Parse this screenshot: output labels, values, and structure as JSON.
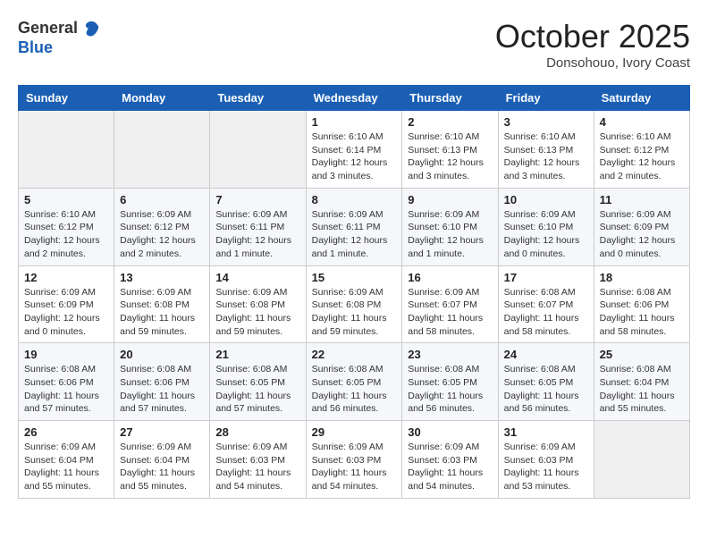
{
  "logo": {
    "general": "General",
    "blue": "Blue"
  },
  "title": "October 2025",
  "location": "Donsohouo, Ivory Coast",
  "weekdays": [
    "Sunday",
    "Monday",
    "Tuesday",
    "Wednesday",
    "Thursday",
    "Friday",
    "Saturday"
  ],
  "weeks": [
    [
      {
        "day": "",
        "info": ""
      },
      {
        "day": "",
        "info": ""
      },
      {
        "day": "",
        "info": ""
      },
      {
        "day": "1",
        "info": "Sunrise: 6:10 AM\nSunset: 6:14 PM\nDaylight: 12 hours and 3 minutes."
      },
      {
        "day": "2",
        "info": "Sunrise: 6:10 AM\nSunset: 6:13 PM\nDaylight: 12 hours and 3 minutes."
      },
      {
        "day": "3",
        "info": "Sunrise: 6:10 AM\nSunset: 6:13 PM\nDaylight: 12 hours and 3 minutes."
      },
      {
        "day": "4",
        "info": "Sunrise: 6:10 AM\nSunset: 6:12 PM\nDaylight: 12 hours and 2 minutes."
      }
    ],
    [
      {
        "day": "5",
        "info": "Sunrise: 6:10 AM\nSunset: 6:12 PM\nDaylight: 12 hours and 2 minutes."
      },
      {
        "day": "6",
        "info": "Sunrise: 6:09 AM\nSunset: 6:12 PM\nDaylight: 12 hours and 2 minutes."
      },
      {
        "day": "7",
        "info": "Sunrise: 6:09 AM\nSunset: 6:11 PM\nDaylight: 12 hours and 1 minute."
      },
      {
        "day": "8",
        "info": "Sunrise: 6:09 AM\nSunset: 6:11 PM\nDaylight: 12 hours and 1 minute."
      },
      {
        "day": "9",
        "info": "Sunrise: 6:09 AM\nSunset: 6:10 PM\nDaylight: 12 hours and 1 minute."
      },
      {
        "day": "10",
        "info": "Sunrise: 6:09 AM\nSunset: 6:10 PM\nDaylight: 12 hours and 0 minutes."
      },
      {
        "day": "11",
        "info": "Sunrise: 6:09 AM\nSunset: 6:09 PM\nDaylight: 12 hours and 0 minutes."
      }
    ],
    [
      {
        "day": "12",
        "info": "Sunrise: 6:09 AM\nSunset: 6:09 PM\nDaylight: 12 hours and 0 minutes."
      },
      {
        "day": "13",
        "info": "Sunrise: 6:09 AM\nSunset: 6:08 PM\nDaylight: 11 hours and 59 minutes."
      },
      {
        "day": "14",
        "info": "Sunrise: 6:09 AM\nSunset: 6:08 PM\nDaylight: 11 hours and 59 minutes."
      },
      {
        "day": "15",
        "info": "Sunrise: 6:09 AM\nSunset: 6:08 PM\nDaylight: 11 hours and 59 minutes."
      },
      {
        "day": "16",
        "info": "Sunrise: 6:09 AM\nSunset: 6:07 PM\nDaylight: 11 hours and 58 minutes."
      },
      {
        "day": "17",
        "info": "Sunrise: 6:08 AM\nSunset: 6:07 PM\nDaylight: 11 hours and 58 minutes."
      },
      {
        "day": "18",
        "info": "Sunrise: 6:08 AM\nSunset: 6:06 PM\nDaylight: 11 hours and 58 minutes."
      }
    ],
    [
      {
        "day": "19",
        "info": "Sunrise: 6:08 AM\nSunset: 6:06 PM\nDaylight: 11 hours and 57 minutes."
      },
      {
        "day": "20",
        "info": "Sunrise: 6:08 AM\nSunset: 6:06 PM\nDaylight: 11 hours and 57 minutes."
      },
      {
        "day": "21",
        "info": "Sunrise: 6:08 AM\nSunset: 6:05 PM\nDaylight: 11 hours and 57 minutes."
      },
      {
        "day": "22",
        "info": "Sunrise: 6:08 AM\nSunset: 6:05 PM\nDaylight: 11 hours and 56 minutes."
      },
      {
        "day": "23",
        "info": "Sunrise: 6:08 AM\nSunset: 6:05 PM\nDaylight: 11 hours and 56 minutes."
      },
      {
        "day": "24",
        "info": "Sunrise: 6:08 AM\nSunset: 6:05 PM\nDaylight: 11 hours and 56 minutes."
      },
      {
        "day": "25",
        "info": "Sunrise: 6:08 AM\nSunset: 6:04 PM\nDaylight: 11 hours and 55 minutes."
      }
    ],
    [
      {
        "day": "26",
        "info": "Sunrise: 6:09 AM\nSunset: 6:04 PM\nDaylight: 11 hours and 55 minutes."
      },
      {
        "day": "27",
        "info": "Sunrise: 6:09 AM\nSunset: 6:04 PM\nDaylight: 11 hours and 55 minutes."
      },
      {
        "day": "28",
        "info": "Sunrise: 6:09 AM\nSunset: 6:03 PM\nDaylight: 11 hours and 54 minutes."
      },
      {
        "day": "29",
        "info": "Sunrise: 6:09 AM\nSunset: 6:03 PM\nDaylight: 11 hours and 54 minutes."
      },
      {
        "day": "30",
        "info": "Sunrise: 6:09 AM\nSunset: 6:03 PM\nDaylight: 11 hours and 54 minutes."
      },
      {
        "day": "31",
        "info": "Sunrise: 6:09 AM\nSunset: 6:03 PM\nDaylight: 11 hours and 53 minutes."
      },
      {
        "day": "",
        "info": ""
      }
    ]
  ]
}
